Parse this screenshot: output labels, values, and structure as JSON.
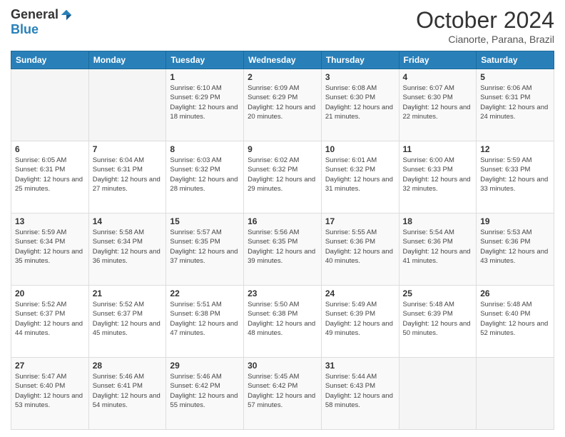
{
  "logo": {
    "general": "General",
    "blue": "Blue"
  },
  "header": {
    "month": "October 2024",
    "location": "Cianorte, Parana, Brazil"
  },
  "days_of_week": [
    "Sunday",
    "Monday",
    "Tuesday",
    "Wednesday",
    "Thursday",
    "Friday",
    "Saturday"
  ],
  "weeks": [
    [
      {
        "day": "",
        "info": ""
      },
      {
        "day": "",
        "info": ""
      },
      {
        "day": "1",
        "info": "Sunrise: 6:10 AM\nSunset: 6:29 PM\nDaylight: 12 hours and 18 minutes."
      },
      {
        "day": "2",
        "info": "Sunrise: 6:09 AM\nSunset: 6:29 PM\nDaylight: 12 hours and 20 minutes."
      },
      {
        "day": "3",
        "info": "Sunrise: 6:08 AM\nSunset: 6:30 PM\nDaylight: 12 hours and 21 minutes."
      },
      {
        "day": "4",
        "info": "Sunrise: 6:07 AM\nSunset: 6:30 PM\nDaylight: 12 hours and 22 minutes."
      },
      {
        "day": "5",
        "info": "Sunrise: 6:06 AM\nSunset: 6:31 PM\nDaylight: 12 hours and 24 minutes."
      }
    ],
    [
      {
        "day": "6",
        "info": "Sunrise: 6:05 AM\nSunset: 6:31 PM\nDaylight: 12 hours and 25 minutes."
      },
      {
        "day": "7",
        "info": "Sunrise: 6:04 AM\nSunset: 6:31 PM\nDaylight: 12 hours and 27 minutes."
      },
      {
        "day": "8",
        "info": "Sunrise: 6:03 AM\nSunset: 6:32 PM\nDaylight: 12 hours and 28 minutes."
      },
      {
        "day": "9",
        "info": "Sunrise: 6:02 AM\nSunset: 6:32 PM\nDaylight: 12 hours and 29 minutes."
      },
      {
        "day": "10",
        "info": "Sunrise: 6:01 AM\nSunset: 6:32 PM\nDaylight: 12 hours and 31 minutes."
      },
      {
        "day": "11",
        "info": "Sunrise: 6:00 AM\nSunset: 6:33 PM\nDaylight: 12 hours and 32 minutes."
      },
      {
        "day": "12",
        "info": "Sunrise: 5:59 AM\nSunset: 6:33 PM\nDaylight: 12 hours and 33 minutes."
      }
    ],
    [
      {
        "day": "13",
        "info": "Sunrise: 5:59 AM\nSunset: 6:34 PM\nDaylight: 12 hours and 35 minutes."
      },
      {
        "day": "14",
        "info": "Sunrise: 5:58 AM\nSunset: 6:34 PM\nDaylight: 12 hours and 36 minutes."
      },
      {
        "day": "15",
        "info": "Sunrise: 5:57 AM\nSunset: 6:35 PM\nDaylight: 12 hours and 37 minutes."
      },
      {
        "day": "16",
        "info": "Sunrise: 5:56 AM\nSunset: 6:35 PM\nDaylight: 12 hours and 39 minutes."
      },
      {
        "day": "17",
        "info": "Sunrise: 5:55 AM\nSunset: 6:36 PM\nDaylight: 12 hours and 40 minutes."
      },
      {
        "day": "18",
        "info": "Sunrise: 5:54 AM\nSunset: 6:36 PM\nDaylight: 12 hours and 41 minutes."
      },
      {
        "day": "19",
        "info": "Sunrise: 5:53 AM\nSunset: 6:36 PM\nDaylight: 12 hours and 43 minutes."
      }
    ],
    [
      {
        "day": "20",
        "info": "Sunrise: 5:52 AM\nSunset: 6:37 PM\nDaylight: 12 hours and 44 minutes."
      },
      {
        "day": "21",
        "info": "Sunrise: 5:52 AM\nSunset: 6:37 PM\nDaylight: 12 hours and 45 minutes."
      },
      {
        "day": "22",
        "info": "Sunrise: 5:51 AM\nSunset: 6:38 PM\nDaylight: 12 hours and 47 minutes."
      },
      {
        "day": "23",
        "info": "Sunrise: 5:50 AM\nSunset: 6:38 PM\nDaylight: 12 hours and 48 minutes."
      },
      {
        "day": "24",
        "info": "Sunrise: 5:49 AM\nSunset: 6:39 PM\nDaylight: 12 hours and 49 minutes."
      },
      {
        "day": "25",
        "info": "Sunrise: 5:48 AM\nSunset: 6:39 PM\nDaylight: 12 hours and 50 minutes."
      },
      {
        "day": "26",
        "info": "Sunrise: 5:48 AM\nSunset: 6:40 PM\nDaylight: 12 hours and 52 minutes."
      }
    ],
    [
      {
        "day": "27",
        "info": "Sunrise: 5:47 AM\nSunset: 6:40 PM\nDaylight: 12 hours and 53 minutes."
      },
      {
        "day": "28",
        "info": "Sunrise: 5:46 AM\nSunset: 6:41 PM\nDaylight: 12 hours and 54 minutes."
      },
      {
        "day": "29",
        "info": "Sunrise: 5:46 AM\nSunset: 6:42 PM\nDaylight: 12 hours and 55 minutes."
      },
      {
        "day": "30",
        "info": "Sunrise: 5:45 AM\nSunset: 6:42 PM\nDaylight: 12 hours and 57 minutes."
      },
      {
        "day": "31",
        "info": "Sunrise: 5:44 AM\nSunset: 6:43 PM\nDaylight: 12 hours and 58 minutes."
      },
      {
        "day": "",
        "info": ""
      },
      {
        "day": "",
        "info": ""
      }
    ]
  ]
}
